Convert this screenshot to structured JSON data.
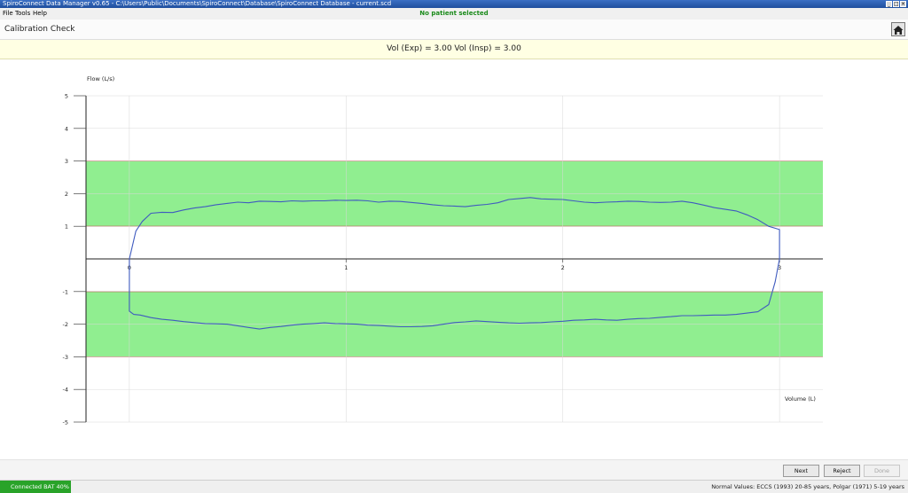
{
  "window": {
    "title": "SpiroConnect Data Manager v0.65 - C:\\Users\\Public\\Documents\\SpiroConnect\\Database\\SpiroConnect Database - current.scd",
    "patient_status": "No patient selected"
  },
  "menu": {
    "file": "File",
    "tools": "Tools",
    "help": "Help"
  },
  "page": {
    "title": "Calibration Check"
  },
  "banner": {
    "text": "Vol (Exp) = 3.00 Vol (Insp) = 3.00"
  },
  "buttons": {
    "next": "Next",
    "reject": "Reject",
    "done": "Done"
  },
  "status": {
    "connected": "Connected BAT 40%",
    "normal_values": "Normal Values: ECCS (1993) 20-85 years, Polgar (1971) 5-19 years"
  },
  "colors": {
    "band": "#90ee90",
    "band_border": "#c0392b",
    "curve": "#3f5bbf",
    "status_green": "#29a329"
  },
  "chart_data": {
    "type": "line",
    "title": "",
    "xlabel": "Volume (L)",
    "ylabel": "Flow (L/s)",
    "xlim": [
      -0.2,
      3.2
    ],
    "ylim": [
      -5,
      5
    ],
    "x_ticks": [
      0,
      1,
      2,
      3
    ],
    "y_ticks": [
      -5,
      -4,
      -3,
      -2,
      -1,
      1,
      2,
      3,
      4,
      5
    ],
    "grid": true,
    "bands": [
      {
        "y_from": 1,
        "y_to": 3
      },
      {
        "y_from": -3,
        "y_to": -1
      }
    ],
    "series": [
      {
        "x": [
          0,
          0.03,
          0.06,
          0.1,
          0.15,
          0.2,
          0.25,
          0.3,
          0.35,
          0.4,
          0.45,
          0.5,
          0.55,
          0.6,
          0.65,
          0.7,
          0.75,
          0.8,
          0.85,
          0.9,
          0.95,
          1.0,
          1.05,
          1.1,
          1.15,
          1.2,
          1.25,
          1.3,
          1.35,
          1.4,
          1.45,
          1.5,
          1.55,
          1.6,
          1.65,
          1.7,
          1.75,
          1.8,
          1.85,
          1.9,
          1.95,
          2.0,
          2.05,
          2.1,
          2.15,
          2.2,
          2.25,
          2.3,
          2.35,
          2.4,
          2.45,
          2.5,
          2.55,
          2.6,
          2.65,
          2.7,
          2.75,
          2.8,
          2.85,
          2.9,
          2.95,
          3.0,
          3.0,
          3.0,
          2.98,
          2.95,
          2.9,
          2.85,
          2.8,
          2.75,
          2.7,
          2.65,
          2.6,
          2.55,
          2.5,
          2.45,
          2.4,
          2.35,
          2.3,
          2.25,
          2.2,
          2.15,
          2.1,
          2.05,
          2.0,
          1.95,
          1.9,
          1.85,
          1.8,
          1.75,
          1.7,
          1.65,
          1.6,
          1.55,
          1.5,
          1.45,
          1.4,
          1.35,
          1.3,
          1.25,
          1.2,
          1.15,
          1.1,
          1.05,
          1.0,
          0.95,
          0.9,
          0.85,
          0.8,
          0.75,
          0.7,
          0.65,
          0.6,
          0.55,
          0.5,
          0.45,
          0.4,
          0.35,
          0.3,
          0.25,
          0.2,
          0.15,
          0.1,
          0.05,
          0.02,
          0,
          0
        ],
        "y": [
          0,
          0.85,
          1.15,
          1.4,
          1.43,
          1.42,
          1.5,
          1.56,
          1.6,
          1.66,
          1.7,
          1.74,
          1.72,
          1.77,
          1.76,
          1.75,
          1.78,
          1.77,
          1.78,
          1.78,
          1.8,
          1.79,
          1.8,
          1.78,
          1.74,
          1.77,
          1.76,
          1.73,
          1.7,
          1.66,
          1.63,
          1.62,
          1.6,
          1.64,
          1.67,
          1.72,
          1.82,
          1.85,
          1.88,
          1.84,
          1.83,
          1.82,
          1.78,
          1.74,
          1.72,
          1.74,
          1.75,
          1.77,
          1.76,
          1.74,
          1.73,
          1.74,
          1.77,
          1.72,
          1.65,
          1.57,
          1.52,
          1.47,
          1.35,
          1.2,
          1.0,
          0.9,
          0.6,
          0,
          -0.7,
          -1.4,
          -1.62,
          -1.66,
          -1.7,
          -1.72,
          -1.72,
          -1.73,
          -1.74,
          -1.74,
          -1.77,
          -1.79,
          -1.82,
          -1.83,
          -1.85,
          -1.88,
          -1.87,
          -1.85,
          -1.87,
          -1.88,
          -1.91,
          -1.93,
          -1.95,
          -1.96,
          -1.97,
          -1.96,
          -1.94,
          -1.92,
          -1.9,
          -1.93,
          -1.95,
          -2.0,
          -2.05,
          -2.07,
          -2.08,
          -2.08,
          -2.06,
          -2.04,
          -2.03,
          -2.0,
          -1.99,
          -1.98,
          -1.96,
          -1.98,
          -2.0,
          -2.03,
          -2.07,
          -2.1,
          -2.15,
          -2.1,
          -2.05,
          -2.0,
          -1.99,
          -1.98,
          -1.95,
          -1.92,
          -1.88,
          -1.85,
          -1.8,
          -1.72,
          -1.7,
          -1.6,
          0
        ]
      }
    ]
  }
}
